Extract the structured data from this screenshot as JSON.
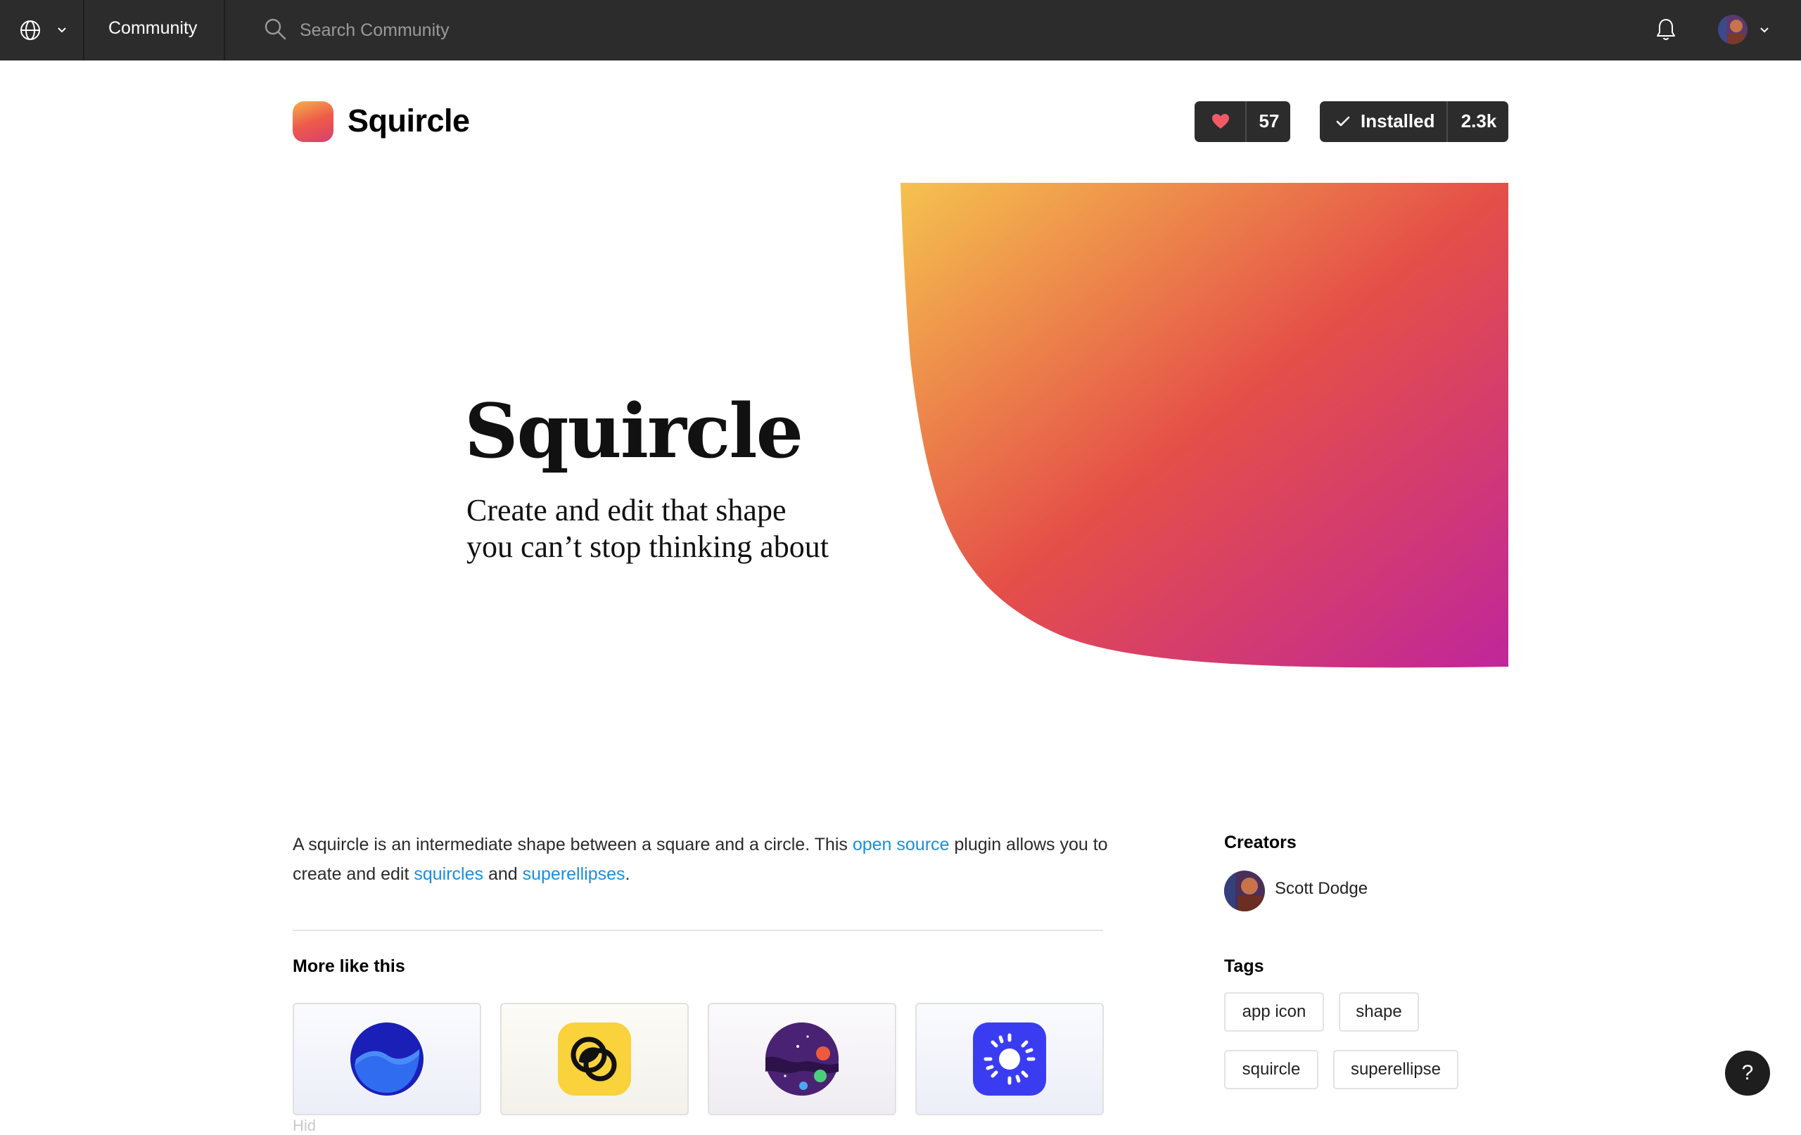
{
  "topbar": {
    "section_label": "Community",
    "search_placeholder": "Search Community"
  },
  "plugin": {
    "name": "Squircle",
    "likes": "57",
    "install_label": "Installed",
    "install_count": "2.3k"
  },
  "hero": {
    "title": "Squircle",
    "subtitle_line1": "Create and edit that shape",
    "subtitle_line2": "you can’t stop thinking about"
  },
  "description": {
    "p1": "A squircle is an intermediate shape between a square and a circle. This ",
    "link1": "open source",
    "p2": " plugin allows you to create and edit ",
    "link2": "squircles",
    "p3": " and ",
    "link3": "superellipses",
    "p4": "."
  },
  "more_like_this": {
    "title": "More like this",
    "cards": [
      {
        "icon": "blue-wave-icon"
      },
      {
        "icon": "yellow-rings-icon"
      },
      {
        "icon": "purple-planet-icon"
      },
      {
        "icon": "blue-sun-icon"
      }
    ],
    "stub_text": "Hid"
  },
  "sidebar": {
    "creators_title": "Creators",
    "creator_name": "Scott Dodge",
    "tags_title": "Tags",
    "tags": [
      "app icon",
      "shape",
      "squircle",
      "superellipse"
    ]
  },
  "help": {
    "label": "?"
  },
  "colors": {
    "topbar": "#2c2c2c",
    "link": "#1a8ee0",
    "gradient_start": "#f5c24e",
    "gradient_mid": "#e54f48",
    "gradient_end": "#c0269a"
  }
}
